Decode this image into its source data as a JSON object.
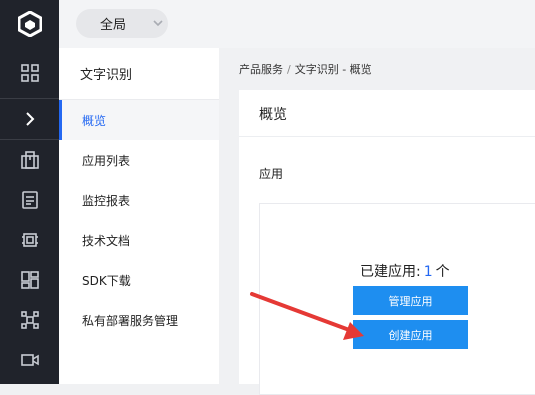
{
  "topbar": {
    "scope_label": "全局"
  },
  "sidebar": {
    "title": "文字识别",
    "items": [
      {
        "label": "概览",
        "active": true
      },
      {
        "label": "应用列表"
      },
      {
        "label": "监控报表"
      },
      {
        "label": "技术文档"
      },
      {
        "label": "SDK下载"
      },
      {
        "label": "私有部署服务管理"
      }
    ]
  },
  "breadcrumb": {
    "part1": "产品服务",
    "separator": "/",
    "part2": "文字识别 - 概览"
  },
  "main": {
    "card_title": "概览",
    "section_title": "应用",
    "apps_prefix": "已建应用:",
    "apps_count": "1",
    "apps_unit": "个",
    "manage_button": "管理应用",
    "create_button": "创建应用"
  },
  "rail_icons": [
    "logo-icon",
    "grid-icon",
    "expand-chevron-icon",
    "building-icon",
    "document-icon",
    "chip-icon",
    "dashboard-icon",
    "network-icon",
    "video-icon"
  ],
  "colors": {
    "accent": "#2468f2",
    "button": "#1e8ef0",
    "rail": "#20232b",
    "annotation_arrow": "#e53935"
  }
}
